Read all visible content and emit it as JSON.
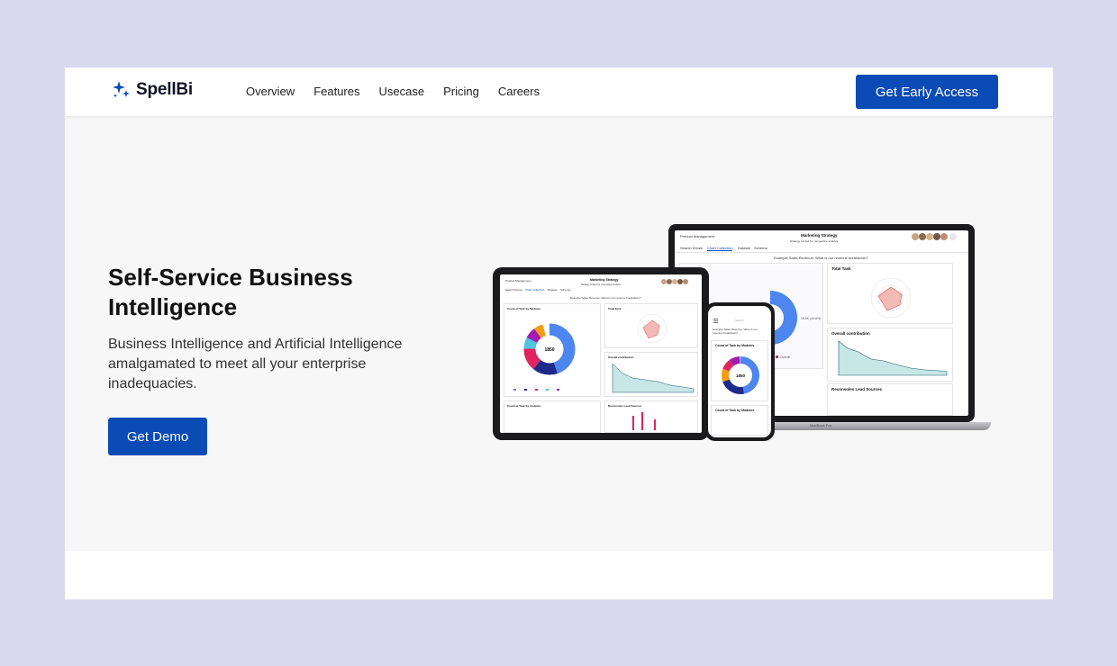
{
  "brand": {
    "name": "SpellBi",
    "accent": "#0a4bb5"
  },
  "nav": {
    "links": [
      "Overview",
      "Features",
      "Usecase",
      "Pricing",
      "Careers"
    ],
    "cta_label": "Get Early Access"
  },
  "hero": {
    "title": "Self-Service Business Intelligence",
    "subtitle": "Business Intelligence and Artificial Intelligence amalgamated to meet all your enterprise inadequacies.",
    "cta_label": "Get Demo"
  },
  "mockup": {
    "laptop": {
      "breadcrumb": "Product Management",
      "title": "Marketing Strategy",
      "subtitle": "Strategy funded for competitive analysis",
      "tabs": [
        "Search Driven",
        "Chart Collection",
        "Dataset",
        "Schema"
      ],
      "query": "Example Sales Revenue: What is our revenue breakdown?",
      "card_titles": [
        "Total Task",
        "Overall contribution",
        "Reconsoles Lead Sources"
      ],
      "base_label": "MacBook Pro",
      "legend_item": "Overall"
    },
    "tablet": {
      "breadcrumb": "Product Management",
      "title": "Marketing Strategy",
      "subtitle": "Strategy funded for competitive analysis",
      "tabs": [
        "Search Driven",
        "Chart Collection",
        "Dataset",
        "Schema"
      ],
      "query": "Example Sales Revenue: What is our revenue breakdown?",
      "card_titles": [
        "Count of Task by Modules",
        "Total Task",
        "Overall contribution",
        "Count of Task by modules",
        "Reconsoles Lead Sources"
      ],
      "donut_value": "1850"
    },
    "phone": {
      "search_placeholder": "Search",
      "query": "Example Sales Revenue: What is our revenue breakdown?",
      "card_title": "Count of Task by Modules",
      "card_title_2": "Count of Task by Modules",
      "donut_value": "1850"
    }
  }
}
